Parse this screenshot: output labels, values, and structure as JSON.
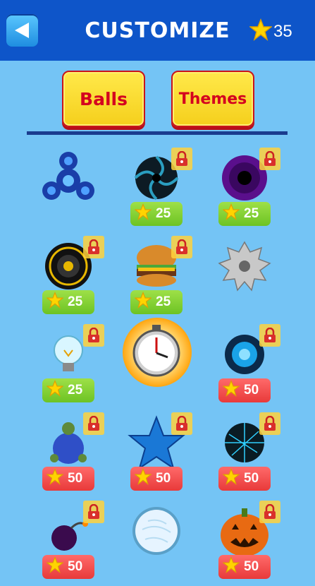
{
  "header": {
    "title": "CUSTOMIZE",
    "stars": "35"
  },
  "tabs": [
    {
      "label": "Balls"
    },
    {
      "label": "Themes"
    }
  ],
  "items": [
    {
      "name": "fidget-spinner",
      "locked": false,
      "price": ""
    },
    {
      "name": "black-swirl-ball",
      "locked": true,
      "price": "25"
    },
    {
      "name": "purple-vortex-ball",
      "locked": true,
      "price": "25"
    },
    {
      "name": "speaker-ball",
      "locked": true,
      "price": "25"
    },
    {
      "name": "burger-ball",
      "locked": true,
      "price": "25"
    },
    {
      "name": "saw-blade-ball",
      "locked": false,
      "price": ""
    },
    {
      "name": "lightbulb-ball",
      "locked": true,
      "price": "25"
    },
    {
      "name": "stopwatch-ball",
      "locked": false,
      "selected": true,
      "price": ""
    },
    {
      "name": "blue-plasma-ball",
      "locked": true,
      "price": "50"
    },
    {
      "name": "turtle-ball",
      "locked": true,
      "price": "50"
    },
    {
      "name": "blue-star-ball",
      "locked": true,
      "price": "50"
    },
    {
      "name": "dark-web-ball",
      "locked": true,
      "price": "50"
    },
    {
      "name": "bomb-ball",
      "locked": true,
      "price": "50"
    },
    {
      "name": "ice-ball",
      "locked": false,
      "price": ""
    },
    {
      "name": "pumpkin-ball",
      "locked": true,
      "price": "50"
    }
  ],
  "colors": {
    "header": "#0e55c9",
    "background": "#74c4f5",
    "tab": "#f5cf1c",
    "tab_text": "#d4001f",
    "price_green": "#7dcc30",
    "price_red": "#ef4545"
  }
}
